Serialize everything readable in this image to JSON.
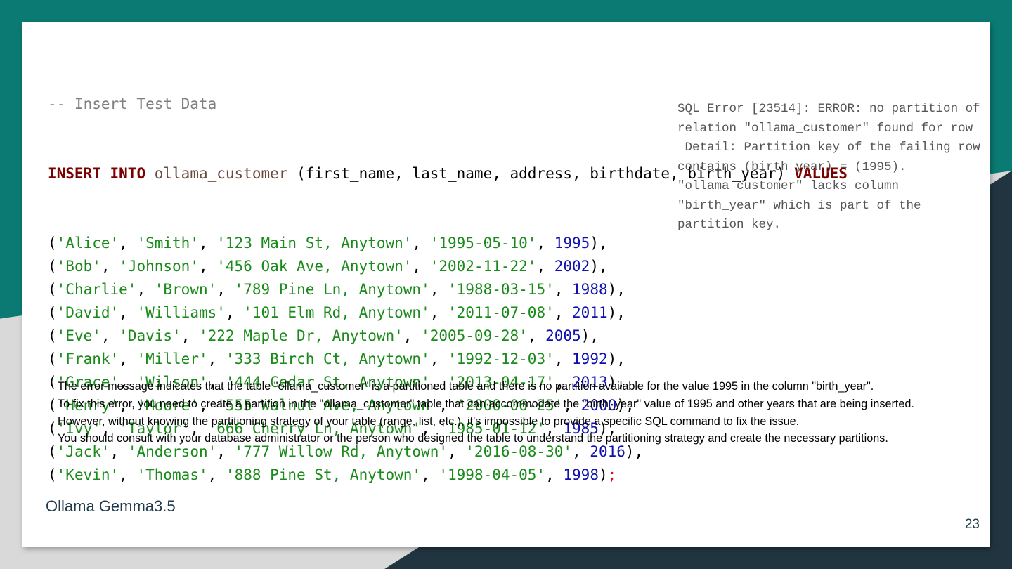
{
  "code": {
    "comment": "-- Insert Test Data",
    "kw_insert": "INSERT",
    "kw_into": "INTO",
    "table": "ollama_customer",
    "columns": "(first_name, last_name, address, birthdate, birth_year)",
    "kw_values": "VALUES",
    "rows": [
      {
        "first": "'Alice'",
        "last": "'Smith'",
        "addr": "'123 Main St, Anytown'",
        "date": "'1995-05-10'",
        "year": "1995",
        "end": "),"
      },
      {
        "first": "'Bob'",
        "last": "'Johnson'",
        "addr": "'456 Oak Ave, Anytown'",
        "date": "'2002-11-22'",
        "year": "2002",
        "end": "),"
      },
      {
        "first": "'Charlie'",
        "last": "'Brown'",
        "addr": "'789 Pine Ln, Anytown'",
        "date": "'1988-03-15'",
        "year": "1988",
        "end": "),"
      },
      {
        "first": "'David'",
        "last": "'Williams'",
        "addr": "'101 Elm Rd, Anytown'",
        "date": "'2011-07-08'",
        "year": "2011",
        "end": "),"
      },
      {
        "first": "'Eve'",
        "last": "'Davis'",
        "addr": "'222 Maple Dr, Anytown'",
        "date": "'2005-09-28'",
        "year": "2005",
        "end": "),"
      },
      {
        "first": "'Frank'",
        "last": "'Miller'",
        "addr": "'333 Birch Ct, Anytown'",
        "date": "'1992-12-03'",
        "year": "1992",
        "end": "),"
      },
      {
        "first": "'Grace'",
        "last": "'Wilson'",
        "addr": "'444 Cedar St, Anytown'",
        "date": "'2013-04-17'",
        "year": "2013",
        "end": "),"
      },
      {
        "first": "'Henry'",
        "last": "'Moore'",
        "addr": "'555 Walnut Ave, Anytown'",
        "date": "'2000-06-25'",
        "year": "2000",
        "end": "),"
      },
      {
        "first": "'Ivy'",
        "last": "'Taylor'",
        "addr": "'666 Cherry Ln, Anytown'",
        "date": "'1985-01-12'",
        "year": "1985",
        "end": "),"
      },
      {
        "first": "'Jack'",
        "last": "'Anderson'",
        "addr": "'777 Willow Rd, Anytown'",
        "date": "'2016-08-30'",
        "year": "2016",
        "end": "),"
      },
      {
        "first": "'Kevin'",
        "last": "'Thomas'",
        "addr": "'888 Pine St, Anytown'",
        "date": "'1998-04-05'",
        "year": "1998",
        "end": ")",
        "semi": ";"
      }
    ]
  },
  "error_message": "SQL Error [23514]: ERROR: no partition of relation \"ollama_customer\" found for row\n Detail: Partition key of the failing row contains (birth_year) = (1995).\n\"ollama_customer\" lacks column \"birth_year\" which is part of the partition key.",
  "explanation": [
    "The error message indicates that the table \"ollama_customer\" is a partitioned table and there is no partition available for the value 1995 in the column \"birth_year\".",
    "To fix this error, you need to create a partition in the \"ollama_customer\" table that can accommodate the \"birth_year\" value of 1995 and other years that are being inserted.",
    "However, without knowing the partitioning strategy of your table (range, list, etc.), it's impossible to provide a specific SQL command to fix the issue.",
    "You should consult with your database administrator or the person who designed the table to understand the partitioning strategy and create the necessary partitions."
  ],
  "footer": "Ollama Gemma3.5",
  "page_number": "23"
}
